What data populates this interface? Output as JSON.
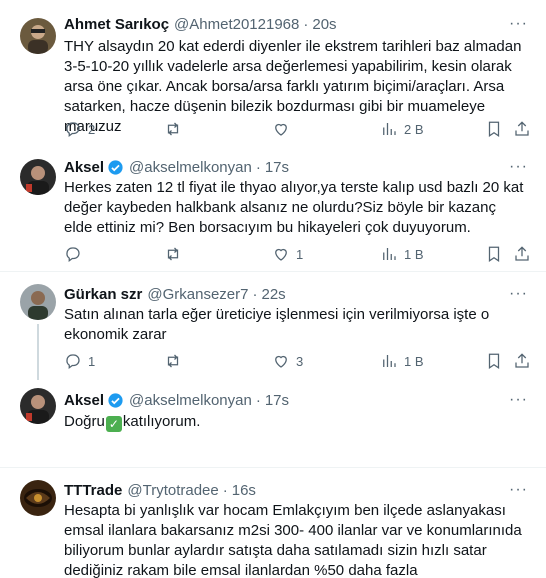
{
  "tweets": [
    {
      "name": "Ahmet Sarıkoç",
      "handle": "@Ahmet20121968",
      "time": "20s",
      "verified": false,
      "text": "THY alsaydın 20 kat ederdi diyenler ile ekstrem tarihleri baz almadan 3-5-10-20 yıllık vadelerle arsa değerlemesi yapabilirim, kesin olarak arsa öne çıkar. Ancak borsa/arsa farklı yatırım biçimi/araçları. Arsa satarken, hacze düşenin bilezik bozdurması gibi bir muameleye maruzuz",
      "replies": "2",
      "retweets": "",
      "likes": "",
      "views": "2 B"
    },
    {
      "name": "Aksel",
      "handle": "@akselmelkonyan",
      "time": "17s",
      "verified": true,
      "text": "Herkes zaten 12 tl fiyat ile thyao alıyor,ya terste kalıp usd bazlı 20 kat değer kaybeden halkbank alsanız ne olurdu?Siz böyle bir kazanç elde ettiniz mi? Ben borsacıyım bu hikayeleri çok duyuyorum.",
      "replies": "",
      "retweets": "",
      "likes": "1",
      "views": "1 B"
    },
    {
      "name": "Gürkan szr",
      "handle": "@Grkansezer7",
      "time": "22s",
      "verified": false,
      "text": "Satın alınan tarla eğer üreticiye işlenmesi için verilmiyorsa işte o ekonomik zarar",
      "replies": "1",
      "retweets": "",
      "likes": "3",
      "views": "1 B"
    },
    {
      "name": "Aksel",
      "handle": "@akselmelkonyan",
      "time": "17s",
      "verified": true,
      "text_before": "Doğru",
      "text_after": "katılıyorum."
    },
    {
      "name": "TTTrade",
      "handle": "@Trytotradee",
      "time": "16s",
      "verified": false,
      "text": "Hesapta bi yanlışlık var hocam  Emlakçıyım ben ilçede aslanyakası emsal ilanlara bakarsanız m2si 300- 400 ilanlar var ve konumlarınıda biliyorum bunlar aylardır satışta daha satılamadı sizin hızlı satar dediğiniz rakam bile emsal ilanlardan %50 daha fazla"
    }
  ],
  "ui": {
    "more_glyph": "···",
    "check_glyph": "✓"
  },
  "colors": {
    "text": "#0f1419",
    "muted": "#536471",
    "verified": "#1d9bf0",
    "divider": "#eff3f4"
  }
}
